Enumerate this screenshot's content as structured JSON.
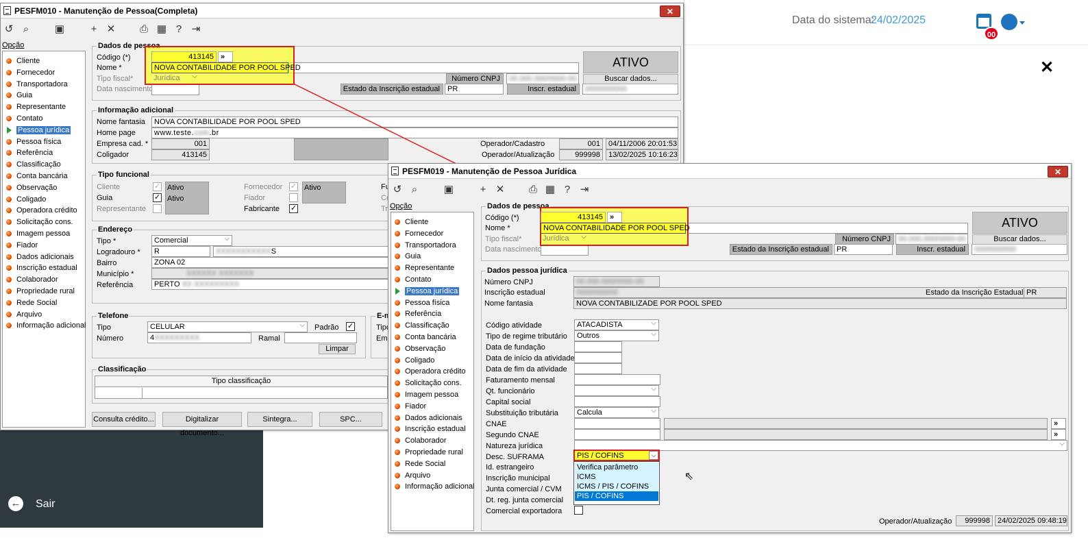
{
  "webapp": {
    "date_label": "Data do sistema:",
    "date_value": "24/02/2025",
    "badge": "00",
    "exit_label": "Sair",
    "close_glyph": "✕"
  },
  "win1": {
    "title": "PESFM010 - Manutenção de Pessoa(Completa)",
    "close": "✕",
    "menu_label": "Opção",
    "menu": [
      "Cliente",
      "Fornecedor",
      "Transportadora",
      "Guia",
      "Representante",
      "Contato",
      "Pessoa jurídica",
      "Pessoa física",
      "Referência",
      "Classificação",
      "Conta bancária",
      "Observação",
      "Coligado",
      "Operadora crédito",
      "Solicitação cons.",
      "Imagem pessoa",
      "Fiador",
      "Dados adicionais",
      "Inscrição estadual",
      "Colaborador",
      "Propriedade rural",
      "Rede Social",
      "Arquivo",
      "Informação adicional"
    ],
    "dados": {
      "title": "Dados de pessoa",
      "codigo_lbl": "Código (*)",
      "codigo": "413145",
      "go": "»",
      "nome_lbl": "Nome *",
      "nome": "NOVA CONTABILIDADE POR POOL SPED",
      "tipo_lbl": "Tipo fiscal*",
      "tipo": "Jurídica",
      "nasc_lbl": "Data nascimento",
      "cnpj_lbl": "Número CNPJ",
      "cnpj": "00.000.000/0000-00",
      "uf_lbl": "Estado da Inscrição estadual",
      "uf": "PR",
      "ie_lbl": "Inscr. estadual",
      "ie": "0000000000",
      "status": "ATIVO",
      "buscar": "Buscar dados..."
    },
    "info": {
      "title": "Informação adicional",
      "fantasia_lbl": "Nome fantasia",
      "fantasia": "NOVA CONTABILIDADE POR POOL SPED",
      "home_lbl": "Home page",
      "home_a": "www.teste.",
      "home_b": "com",
      "home_c": ".br",
      "emp_lbl": "Empresa cad. *",
      "emp": "001",
      "colig_lbl": "Coligador",
      "colig": "413145",
      "opcad_lbl": "Operador/Cadastro",
      "opcad": "001",
      "opcad_dt": "04/11/2006 20:01:53",
      "opat_lbl": "Operador/Atualização",
      "opat": "999998",
      "opat_dt": "13/02/2025 10:16:23"
    },
    "func": {
      "title": "Tipo funcional",
      "cliente": "Cliente",
      "guia": "Guia",
      "repres": "Representante",
      "ativo": "Ativo",
      "fornecedor": "Fornecedor",
      "fiador": "Fiador",
      "fabricante": "Fabricante",
      "fu": "Fu",
      "co": "Co",
      "tr": "Tr"
    },
    "end": {
      "title": "Endereço",
      "tipo_lbl": "Tipo *",
      "tipo": "Comercial",
      "log_lbl": "Logradouro *",
      "log_a": "R",
      "log_b": "XXXXXXXXXXX",
      "log_c": "S",
      "bairro_lbl": "Bairro",
      "bairro": "ZONA 02",
      "mun_lbl": "Município *",
      "mun": "XXXXXX XXXXXXX",
      "ref_lbl": "Referência",
      "ref_a": "PERTO",
      "ref_b": "XX XXXXXXXXX"
    },
    "tel": {
      "title": "Telefone",
      "tipo_lbl": "Tipo",
      "tipo": "CELULAR",
      "padrao": "Padrão",
      "num_lbl": "Número",
      "num_a": "4",
      "num_b": "XXXXXXXXX",
      "ramal": "Ramal",
      "limpar": "Limpar",
      "email_title": "E-m",
      "email_tipo": "Tipo",
      "email_em": "Ema"
    },
    "class": {
      "title": "Classificação",
      "col": "Tipo classificação"
    },
    "buttons": [
      "Consulta crédito...",
      "Digitalizar documento...",
      "Sintegra...",
      "SPC..."
    ]
  },
  "win2": {
    "title": "PESFM019 - Manutenção de Pessoa Jurídica",
    "close": "✕",
    "menu_label": "Opção",
    "menu": [
      "Cliente",
      "Fornecedor",
      "Transportadora",
      "Guia",
      "Representante",
      "Contato",
      "Pessoa jurídica",
      "Pessoa física",
      "Referência",
      "Classificação",
      "Conta bancária",
      "Observação",
      "Coligado",
      "Operadora crédito",
      "Solicitação cons.",
      "Imagem pessoa",
      "Fiador",
      "Dados adicionais",
      "Inscrição estadual",
      "Colaborador",
      "Propriedade rural",
      "Rede Social",
      "Arquivo",
      "Informação adicional"
    ],
    "dados": {
      "title": "Dados de pessoa",
      "codigo_lbl": "Código (*)",
      "codigo": "413145",
      "go": "»",
      "nome_lbl": "Nome *",
      "nome": "NOVA CONTABILIDADE POR POOL SPED",
      "tipo_lbl": "Tipo fiscal*",
      "tipo": "Jurídica",
      "nasc_lbl": "Data nascimento",
      "cnpj_lbl": "Número CNPJ",
      "cnpj": "00.000.000/0000-00",
      "uf_lbl": "Estado da Inscrição estadual",
      "uf": "PR",
      "ie_lbl": "Inscr. estadual",
      "ie": "0000000000",
      "status": "ATIVO",
      "buscar": "Buscar dados..."
    },
    "pj": {
      "title": "Dados pessoa jurídica",
      "cnpj_lbl": "Número CNPJ",
      "cnpj": "00.000.000/0000-00",
      "ie_lbl": "Inscrição estadual",
      "ie": "0000000000",
      "uf_lbl": "Estado da Inscrição Estadual",
      "uf": "PR",
      "fantasia_lbl": "Nome fantasia",
      "fantasia": "NOVA CONTABILIZADE POR POOL SPED",
      "cod_ativ_lbl": "Código atividade",
      "cod_ativ": "ATACADISTA",
      "regime_lbl": "Tipo de regime tributário",
      "regime": "Outros",
      "fund_lbl": "Data de fundação",
      "ini_lbl": "Data de início da atividade",
      "fim_lbl": "Data de fim da atividade",
      "fat_lbl": "Faturamento mensal",
      "qt_lbl": "Qt. funcionário",
      "cap_lbl": "Capital social",
      "subst_lbl": "Substituição tributária",
      "subst": "Calcula",
      "cnae_lbl": "CNAE",
      "cnae2_lbl": "Segundo CNAE",
      "nat_lbl": "Natureza jurídica",
      "suf_lbl": "Desc. SUFRAMA",
      "suf": "PIS / COFINS",
      "idest_lbl": "Id. estrangeiro",
      "insmun_lbl": "Inscrição municipal",
      "junta_lbl": "Junta comercial / CVM",
      "dtjunta_lbl": "Dt. reg. junta comercial",
      "export_lbl": "Comercial exportadora",
      "go": "»",
      "options": [
        "Verifica parâmetro",
        "ICMS",
        "ICMS / PIS / COFINS",
        "PIS / COFINS"
      ],
      "opat_lbl": "Operador/Atualização",
      "opat": "999998",
      "opat_dt": "24/02/2025 09:48:19"
    }
  }
}
